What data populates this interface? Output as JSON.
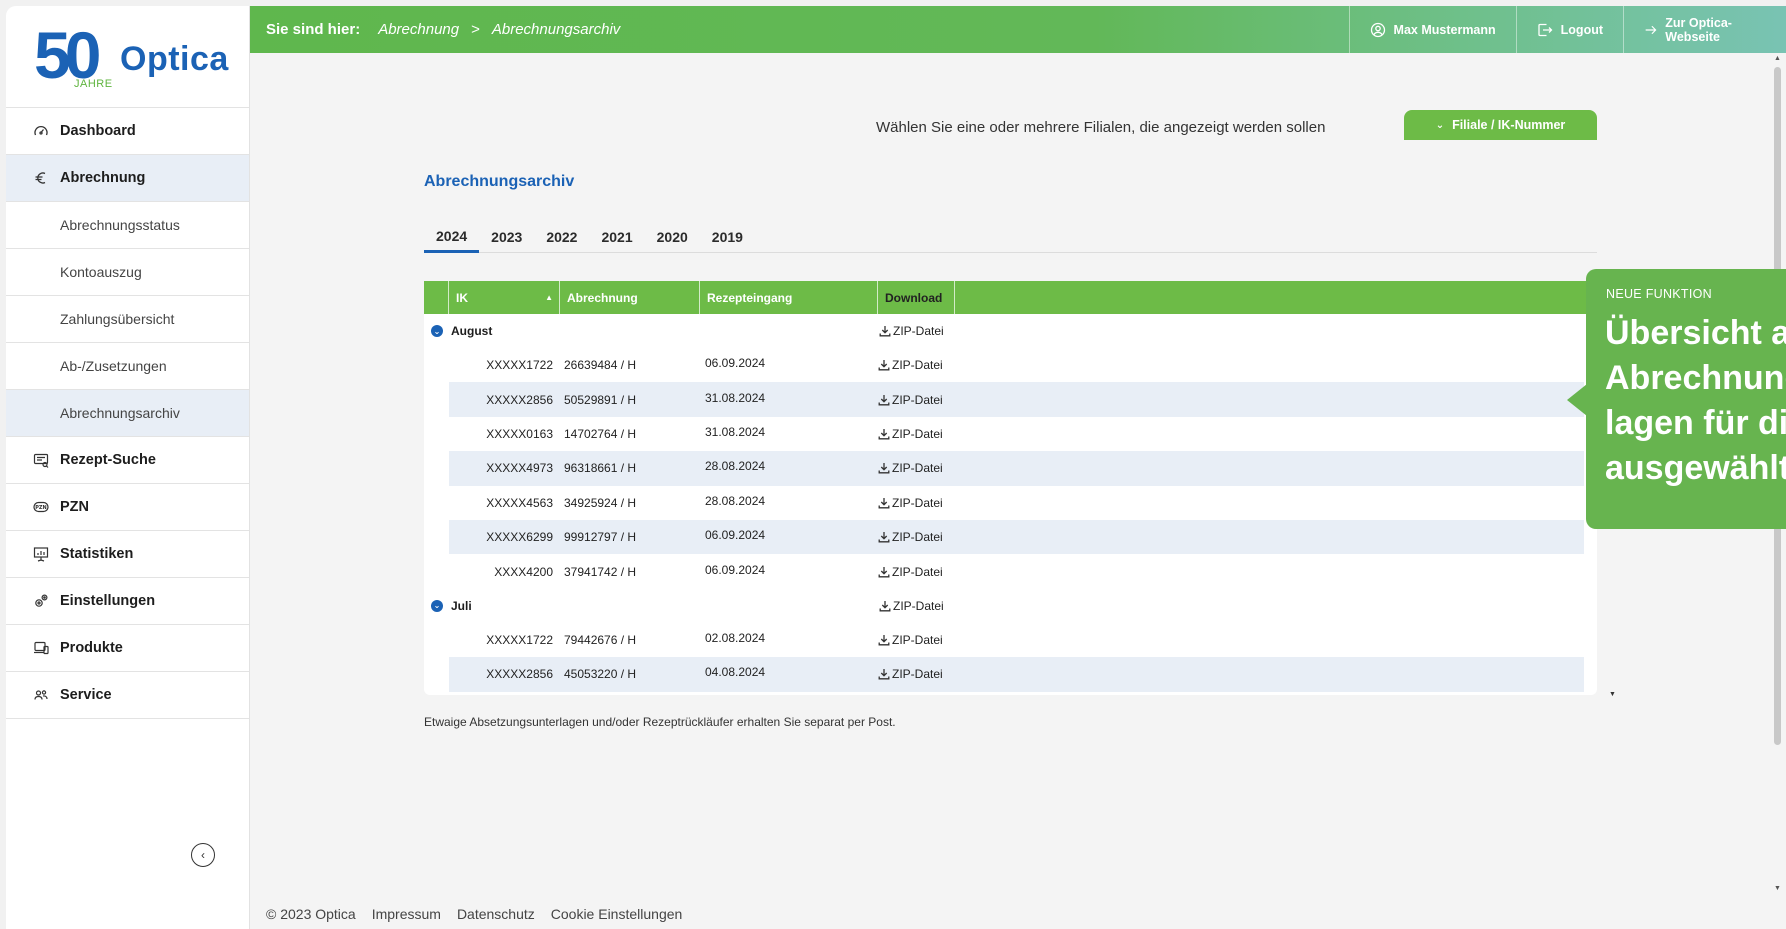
{
  "brand": {
    "anniversary": "50",
    "anniversary_sub": "JAHRE",
    "name": "Optica"
  },
  "sidebar": {
    "items": [
      {
        "label": "Dashboard",
        "icon": "speedometer-icon"
      },
      {
        "label": "Abrechnung",
        "icon": "euro-icon"
      },
      {
        "label": "Abrechnungsstatus"
      },
      {
        "label": "Kontoauszug"
      },
      {
        "label": "Zahlungsübersicht"
      },
      {
        "label": "Ab-/Zusetzungen"
      },
      {
        "label": "Abrechnungsarchiv"
      },
      {
        "label": "Rezept-Suche",
        "icon": "prescription-icon"
      },
      {
        "label": "PZN",
        "icon": "pzn-icon"
      },
      {
        "label": "Statistiken",
        "icon": "presentation-chart-icon"
      },
      {
        "label": "Einstellungen",
        "icon": "gears-icon"
      },
      {
        "label": "Produkte",
        "icon": "devices-icon"
      },
      {
        "label": "Service",
        "icon": "people-icon"
      }
    ],
    "collapse_icon": "chevron-left-icon"
  },
  "header": {
    "lead": "Sie sind hier:",
    "breadcrumb": [
      "Abrechnung",
      "Abrechnungsarchiv"
    ],
    "separator": ">",
    "user": "Max Mustermann",
    "logout": "Logout",
    "website": "Zur Optica-Webseite"
  },
  "filter": {
    "text": "Wählen Sie eine oder mehrere Filialen, die angezeigt werden sollen",
    "button": "Filiale / IK-Nummer"
  },
  "page": {
    "title": "Abrechnungsarchiv"
  },
  "years": [
    "2024",
    "2023",
    "2022",
    "2021",
    "2020",
    "2019"
  ],
  "table": {
    "headers": {
      "ik": "IK",
      "abrechnung": "Abrechnung",
      "rezepteingang": "Rezepteingang",
      "download": "Download"
    },
    "download_label": "ZIP-Datei",
    "groups": [
      {
        "name": "August",
        "rows": [
          {
            "ik": "XXXXX1722",
            "abrechnung": "26639484 / H",
            "rezepteingang": "06.09.2024"
          },
          {
            "ik": "XXXXX2856",
            "abrechnung": "50529891 / H",
            "rezepteingang": "31.08.2024"
          },
          {
            "ik": "XXXXX0163",
            "abrechnung": "14702764 / H",
            "rezepteingang": "31.08.2024"
          },
          {
            "ik": "XXXXX4973",
            "abrechnung": "96318661 / H",
            "rezepteingang": "28.08.2024"
          },
          {
            "ik": "XXXXX4563",
            "abrechnung": "34925924 / H",
            "rezepteingang": "28.08.2024"
          },
          {
            "ik": "XXXXX6299",
            "abrechnung": "99912797 / H",
            "rezepteingang": "06.09.2024"
          },
          {
            "ik": "XXXX4200",
            "abrechnung": "37941742 / H",
            "rezepteingang": "06.09.2024"
          }
        ]
      },
      {
        "name": "Juli",
        "rows": [
          {
            "ik": "XXXXX1722",
            "abrechnung": "79442676 / H",
            "rezepteingang": "02.08.2024"
          },
          {
            "ik": "XXXXX2856",
            "abrechnung": "45053220 / H",
            "rezepteingang": "04.08.2024"
          }
        ]
      }
    ]
  },
  "note": "Etwaige Absetzungsunterlagen und/oder Rezeptrückläufer erhalten Sie separat per Post.",
  "footer": {
    "copyright": "© 2023 Optica",
    "links": [
      "Impressum",
      "Datenschutz",
      "Cookie Einstellungen"
    ]
  },
  "tooltip": {
    "tag": "NEUE FUNKTION",
    "body": "Übersicht a\nAbrechnung\nlagen für di\nausgewählt"
  },
  "colors": {
    "primary_blue": "#1b62b5",
    "green": "#6dbb47",
    "row_alt": "#e8eef6"
  }
}
